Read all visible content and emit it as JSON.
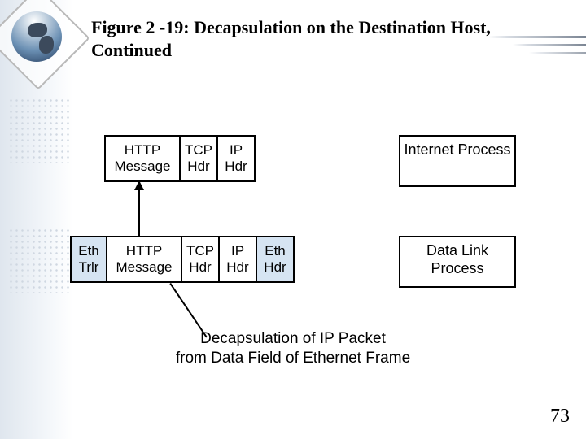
{
  "title": "Figure 2 -19: Decapsulation on the Destination Host, Continued",
  "upper_packet": {
    "http": "HTTP\nMessage",
    "tcp": "TCP\nHdr",
    "ip": "IP\nHdr"
  },
  "lower_packet": {
    "eth_trlr": "Eth\nTrlr",
    "http": "HTTP\nMessage",
    "tcp": "TCP\nHdr",
    "ip": "IP\nHdr",
    "eth_hdr": "Eth\nHdr"
  },
  "processes": {
    "internet": "Internet\nProcess",
    "datalink": "Data Link\nProcess"
  },
  "caption_line1": "Decapsulation of IP Packet",
  "caption_line2": "from Data Field of Ethernet Frame",
  "page_number": "73"
}
